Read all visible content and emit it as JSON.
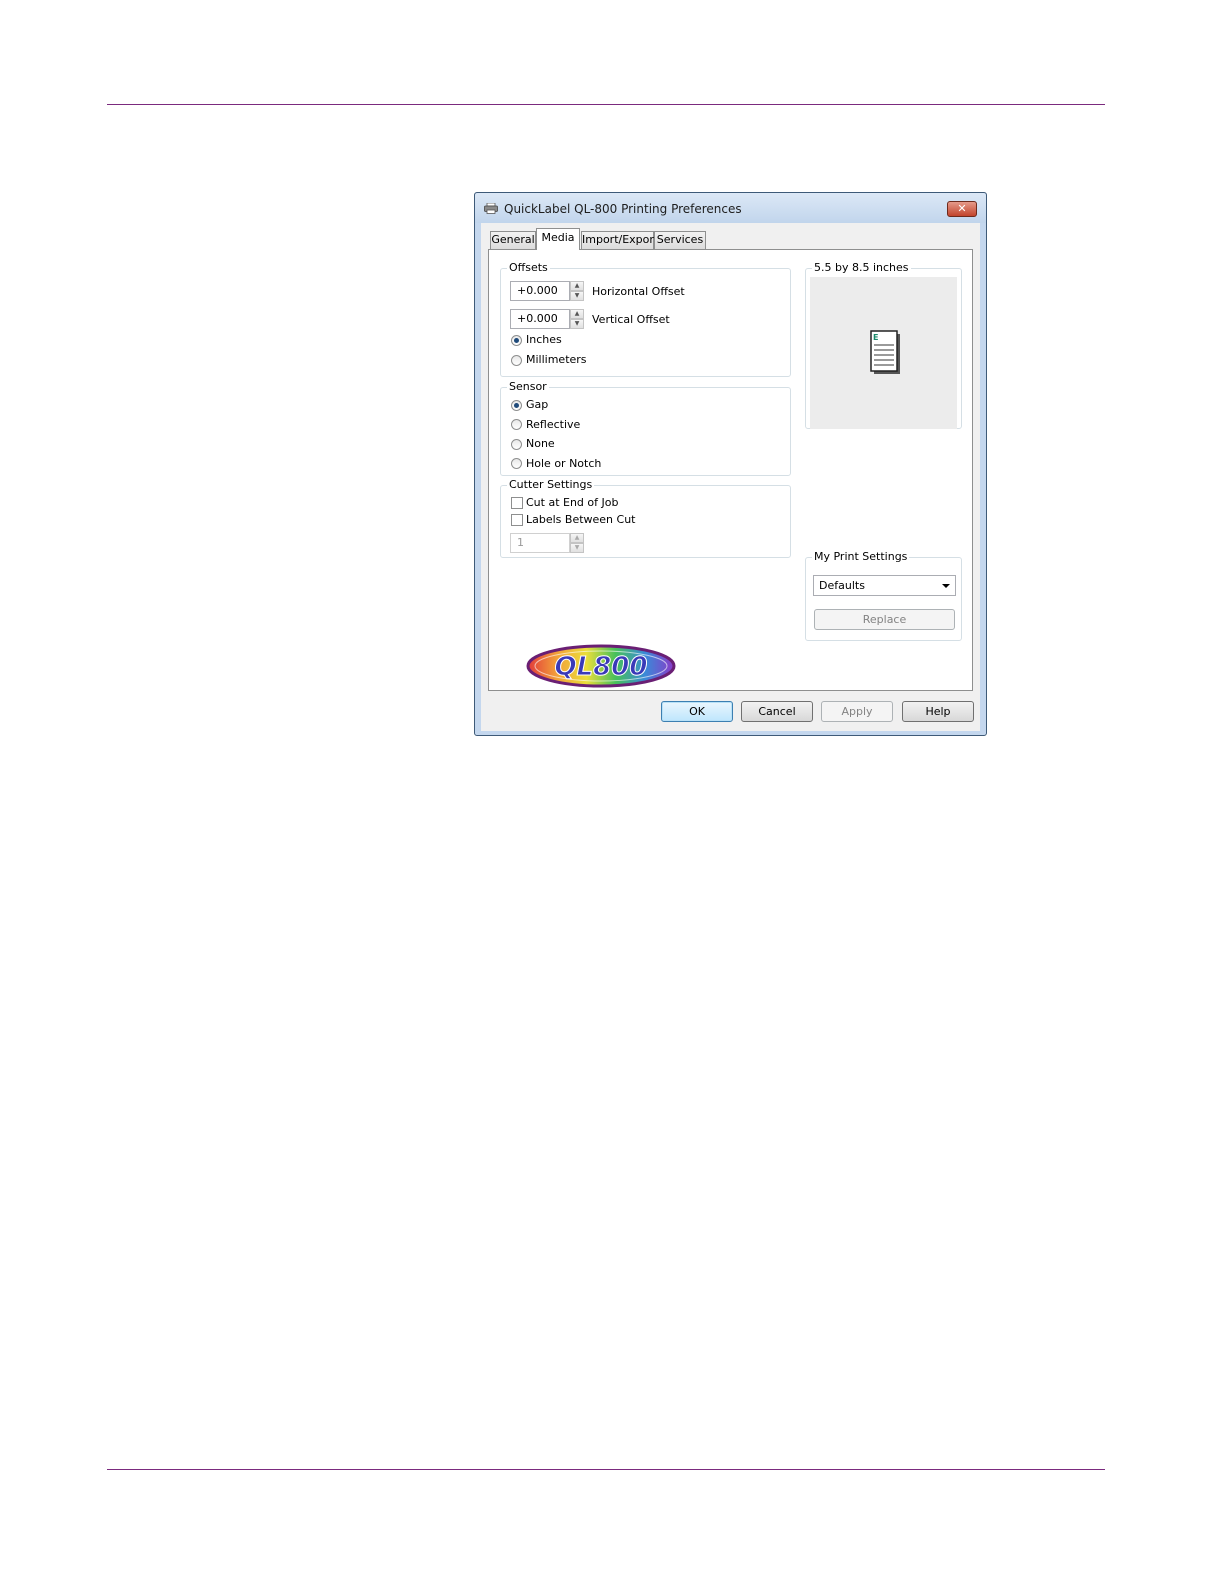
{
  "dialog": {
    "title": "QuickLabel QL-800 Printing Preferences",
    "close_icon": "close-icon",
    "printer_icon": "printer-icon"
  },
  "tabs": [
    {
      "label": "General",
      "active": false
    },
    {
      "label": "Media",
      "active": true
    },
    {
      "label": "Import/Export",
      "active": false
    },
    {
      "label": "Services",
      "active": false
    }
  ],
  "offsets": {
    "group_label": "Offsets",
    "horizontal_value": "+0.000",
    "horizontal_label": "Horizontal Offset",
    "vertical_value": "+0.000",
    "vertical_label": "Vertical Offset",
    "units": [
      {
        "label": "Inches",
        "selected": true
      },
      {
        "label": "Millimeters",
        "selected": false
      }
    ]
  },
  "sensor": {
    "group_label": "Sensor",
    "options": [
      {
        "label": "Gap",
        "selected": true
      },
      {
        "label": "Reflective",
        "selected": false
      },
      {
        "label": "None",
        "selected": false
      },
      {
        "label": "Hole or Notch",
        "selected": false
      }
    ]
  },
  "cutter": {
    "group_label": "Cutter Settings",
    "cut_at_end_label": "Cut at End of Job",
    "cut_at_end_checked": false,
    "labels_between_label": "Labels Between Cut",
    "labels_between_checked": false,
    "count_value": "1"
  },
  "preview": {
    "group_label": "5.5 by 8.5 inches",
    "page_letter": "E"
  },
  "my_print_settings": {
    "group_label": "My Print Settings",
    "selected": "Defaults",
    "replace_label": "Replace"
  },
  "logo": {
    "text": "QL800"
  },
  "buttons": {
    "ok": "OK",
    "cancel": "Cancel",
    "apply": "Apply",
    "help": "Help"
  },
  "colors": {
    "accent": "#7b2a7e",
    "selection": "#1f4a7a",
    "window_frame": "#c4d7ee"
  }
}
